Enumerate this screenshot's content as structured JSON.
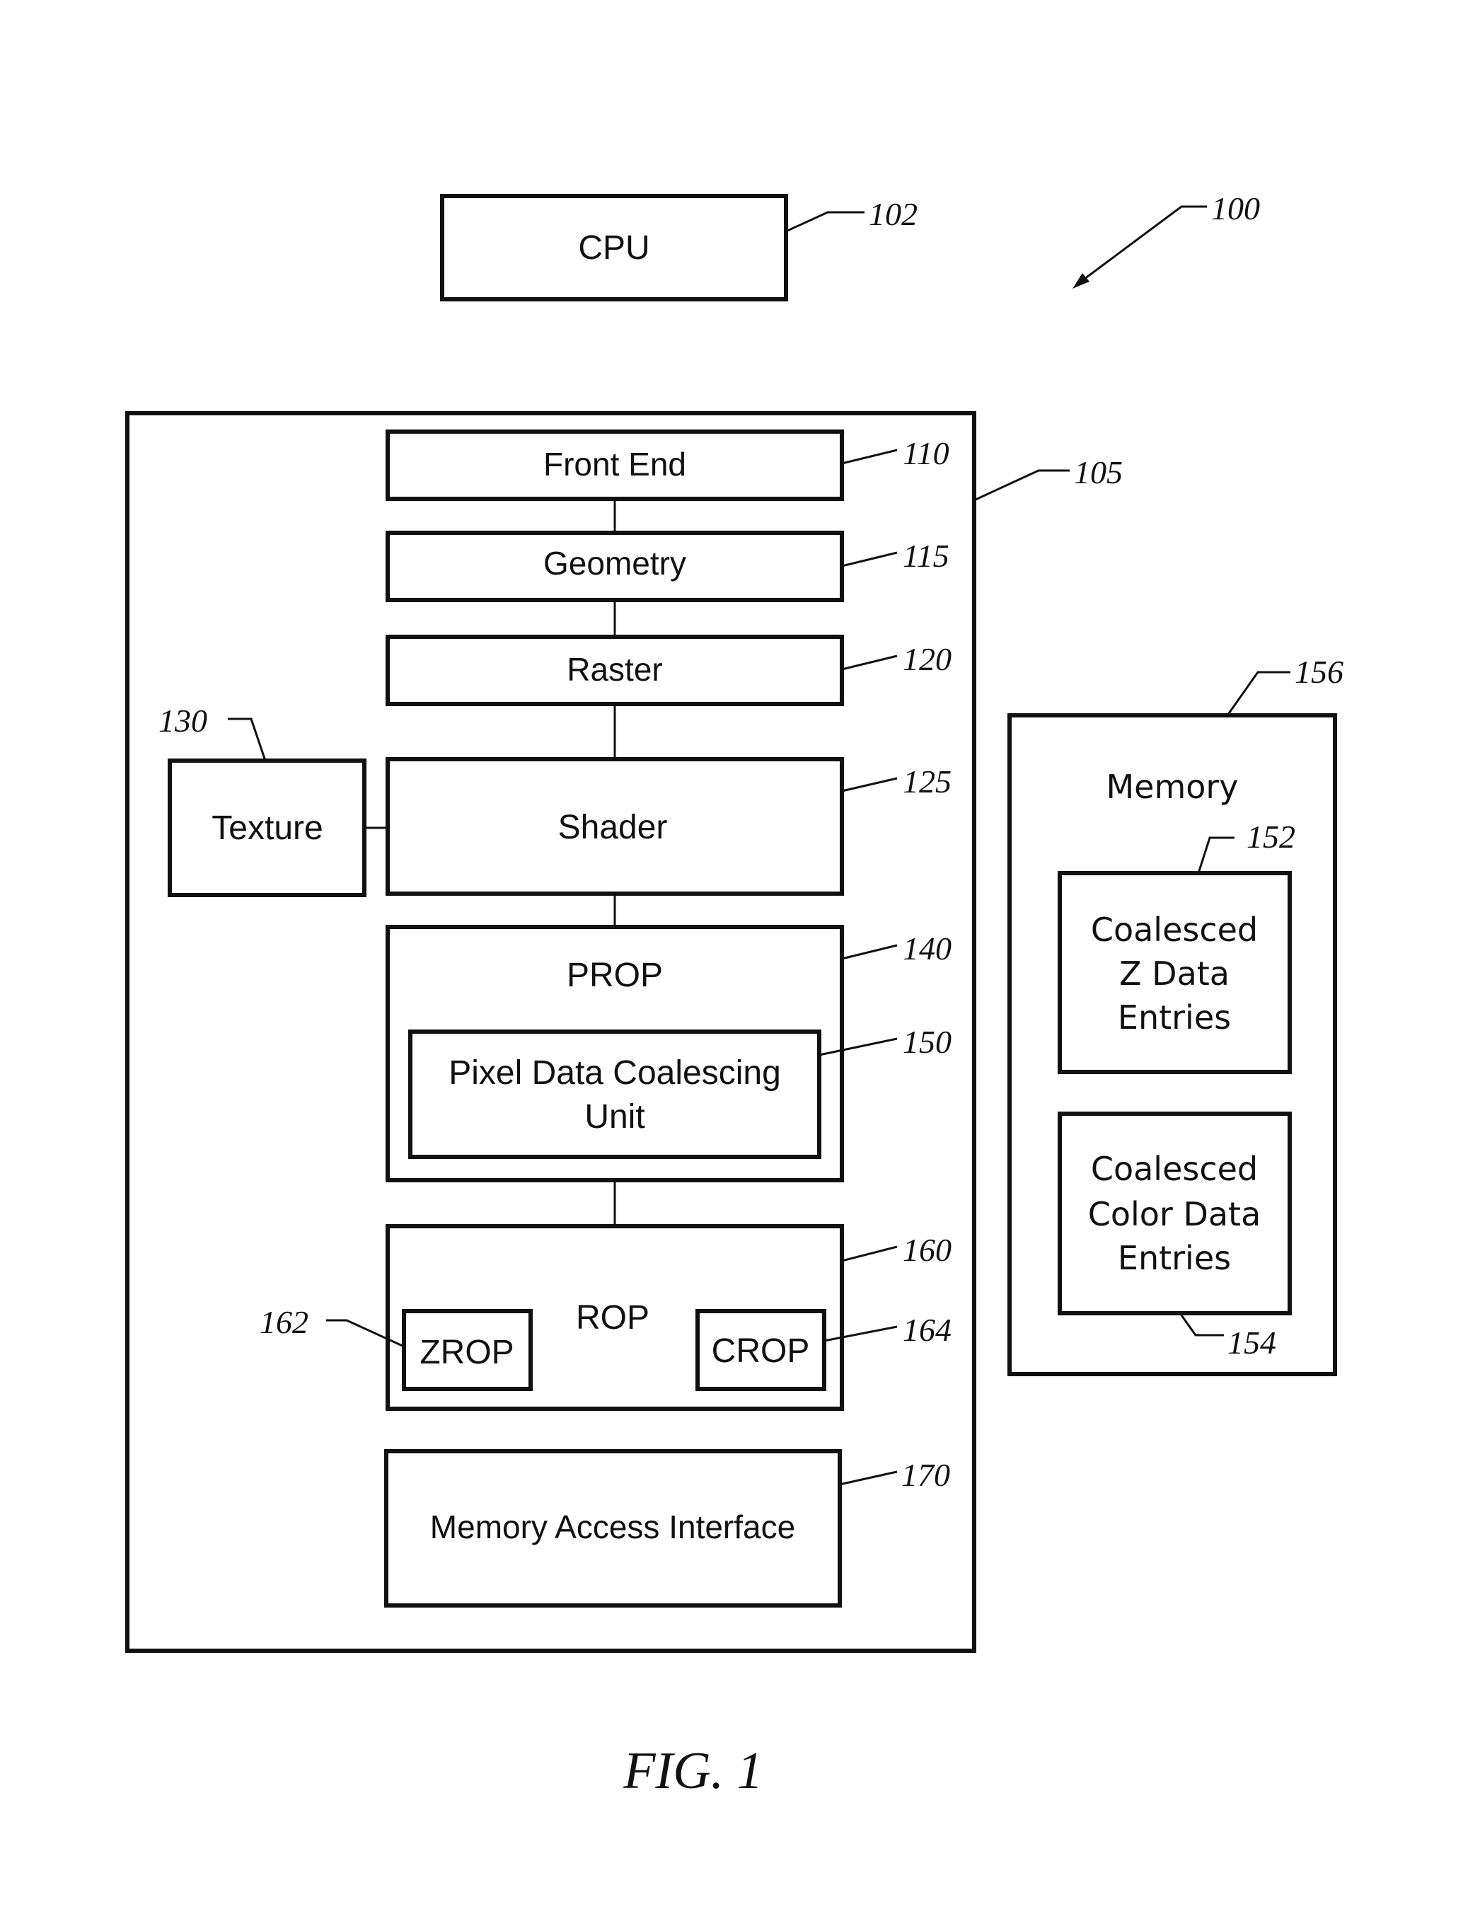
{
  "figure": {
    "caption": "FIG. 1",
    "system_ref": "100"
  },
  "cpu": {
    "label": "CPU",
    "ref": "102"
  },
  "gpu": {
    "ref": "105",
    "front_end": {
      "label": "Front End",
      "ref": "110"
    },
    "geometry": {
      "label": "Geometry",
      "ref": "115"
    },
    "raster": {
      "label": "Raster",
      "ref": "120"
    },
    "shader": {
      "label": "Shader",
      "ref": "125"
    },
    "texture": {
      "label": "Texture",
      "ref": "130"
    },
    "prop": {
      "label": "PROP",
      "ref": "140",
      "coalescing_unit": {
        "line1": "Pixel Data Coalescing",
        "line2": "Unit",
        "ref": "150"
      }
    },
    "rop": {
      "label": "ROP",
      "ref": "160",
      "zrop": {
        "label": "ZROP",
        "ref": "162"
      },
      "crop": {
        "label": "CROP",
        "ref": "164"
      }
    },
    "memory_access_interface": {
      "label": "Memory Access Interface",
      "ref": "170"
    }
  },
  "memory": {
    "label": "Memory",
    "ref": "156",
    "z_entries": {
      "line1": "Coalesced",
      "line2": "Z Data",
      "line3": "Entries",
      "ref": "152"
    },
    "color_entries": {
      "line1": "Coalesced",
      "line2": "Color Data",
      "line3": "Entries",
      "ref": "154"
    }
  }
}
